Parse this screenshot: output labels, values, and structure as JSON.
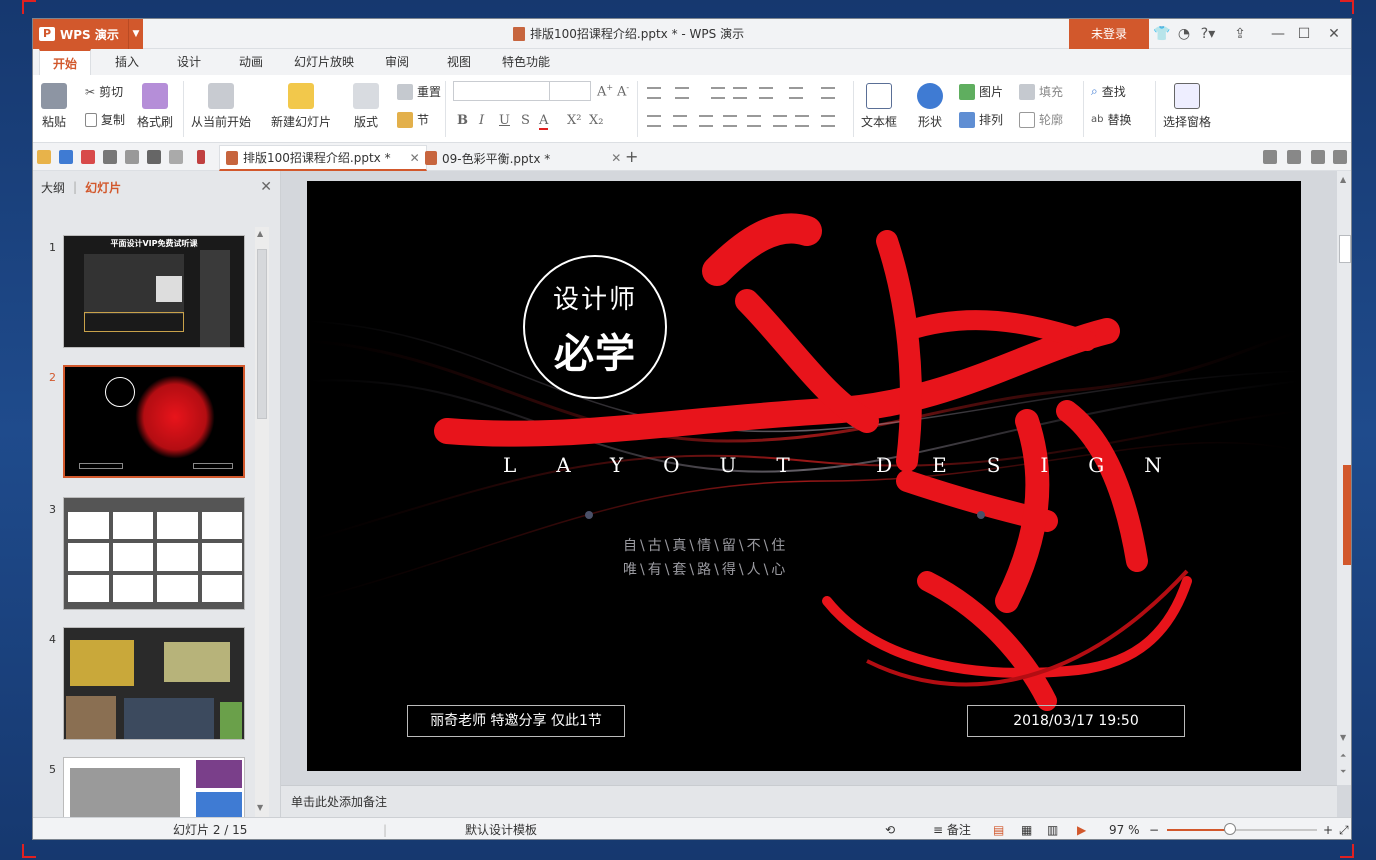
{
  "window": {
    "app_button": "WPS 演示",
    "doc_title": "排版100招课程介绍.pptx * - WPS 演示",
    "login": "未登录",
    "title_icons": [
      "shirt-icon",
      "weibo-icon",
      "help-icon",
      "upload-icon",
      "minimize-icon",
      "maximize-icon",
      "close-icon"
    ]
  },
  "menu": {
    "tabs": [
      "开始",
      "插入",
      "设计",
      "动画",
      "幻灯片放映",
      "审阅",
      "视图",
      "特色功能"
    ],
    "active": "开始"
  },
  "ribbon": {
    "paste": "粘贴",
    "cut": "剪切",
    "copy": "复制",
    "format_painter": "格式刷",
    "from_current": "从当前开始",
    "new_slide": "新建幻灯片",
    "layout": "版式",
    "reset": "重置",
    "section": "节",
    "text_box": "文本框",
    "shape": "形状",
    "picture": "图片",
    "fill": "填充",
    "arrange": "排列",
    "outline": "轮廓",
    "find": "查找",
    "replace": "替换",
    "select_pane": "选择窗格",
    "font_glyphs": [
      "B",
      "I",
      "U",
      "S",
      "A",
      "X²",
      "X₂"
    ],
    "font_name": "",
    "font_size": ""
  },
  "doc_tabs": [
    {
      "label": "排版100招课程介绍.pptx *",
      "active": true
    },
    {
      "label": "09-色彩平衡.pptx *",
      "active": false
    }
  ],
  "left_panel": {
    "tab_outline": "大纲",
    "tab_slides": "幻灯片",
    "slides": [
      {
        "num": "1",
        "caption": "平面设计VIP免费试听课"
      },
      {
        "num": "2",
        "caption": ""
      },
      {
        "num": "3",
        "caption": ""
      },
      {
        "num": "4",
        "caption": ""
      },
      {
        "num": "5",
        "caption": ""
      }
    ],
    "selected": "2"
  },
  "slide": {
    "circle_line1": "设计师",
    "circle_line2": "必学",
    "big_calligraphy": "套路",
    "layout_design": "LAYOUT DESIGN",
    "poem_line1": "自\\古\\真\\情\\留\\不\\住",
    "poem_line2": "唯\\有\\套\\路\\得\\人\\心",
    "left_box": "丽奇老师 特邀分享 仅此1节",
    "right_box": "2018/03/17 19:50"
  },
  "notes": {
    "placeholder": "单击此处添加备注"
  },
  "status": {
    "slide_counter": "幻灯片 2 / 15",
    "template": "默认设计模板",
    "notes_btn": "备注",
    "zoom": "97 %",
    "zoom_value": 0.42
  },
  "colors": {
    "accent": "#d2582c",
    "slide_red": "#e8141b"
  }
}
